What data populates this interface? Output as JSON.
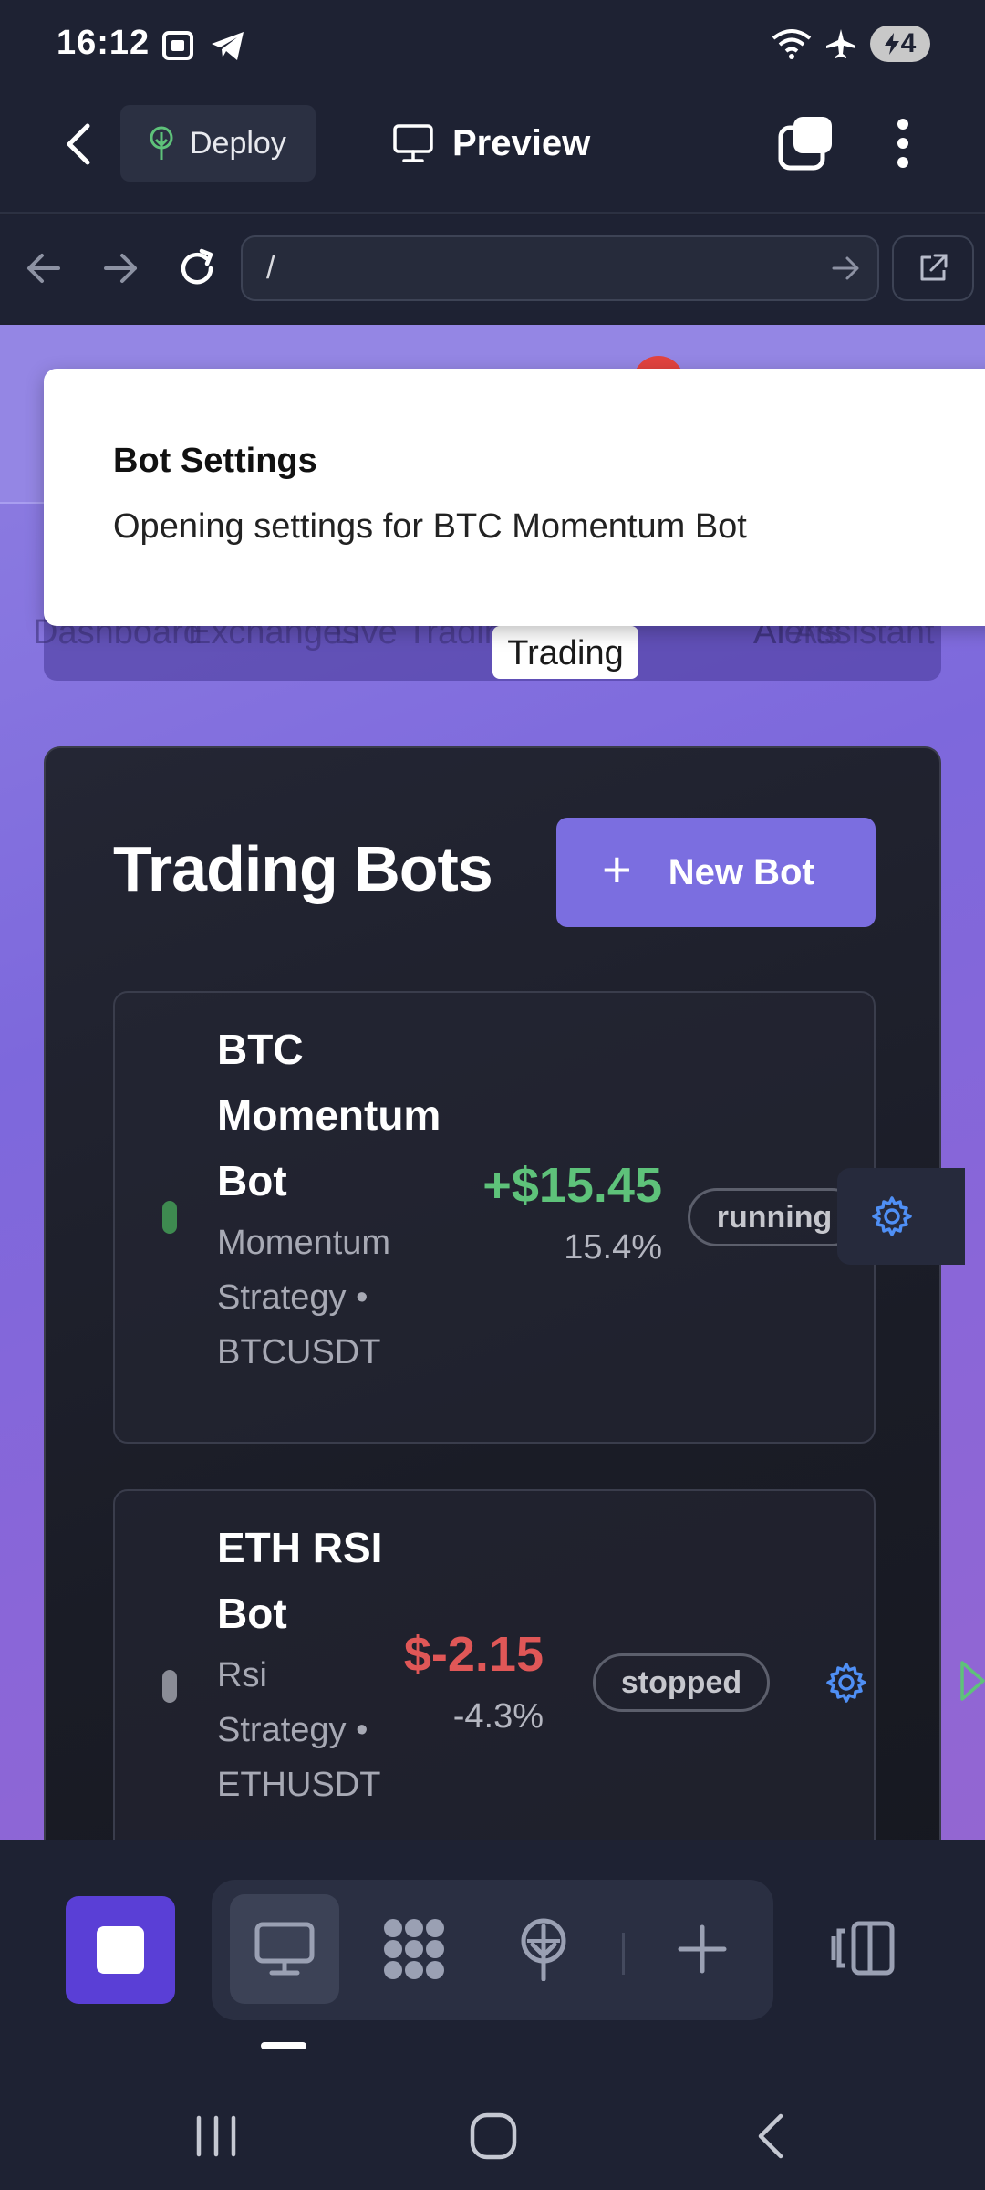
{
  "status_bar": {
    "time": "16:12",
    "battery_level": "4",
    "icons": [
      "screenshot-icon",
      "telegram-icon",
      "wifi-icon",
      "airplane-icon",
      "battery-charging-icon"
    ]
  },
  "app_bar": {
    "deploy_label": "Deploy",
    "preview_label": "Preview"
  },
  "browser": {
    "url": "/"
  },
  "web": {
    "nav_links": [
      "Dashboard",
      "Exchanges",
      "Live Trading",
      "Trading Bots",
      "Alerts",
      "AI Assistant"
    ],
    "nav_active": "Trading Bots",
    "toast": {
      "title": "Bot Settings",
      "description": "Opening settings for BTC Momentum Bot"
    },
    "panel": {
      "title": "Trading Bots",
      "new_bot_label": "New Bot",
      "new_bot_plus": "+"
    },
    "bots": [
      {
        "name_lines": [
          "BTC",
          "Momentum",
          "Bot"
        ],
        "sub_lines": [
          "Momentum",
          "Strategy •",
          "BTCUSDT"
        ],
        "pnl": "+$15.45",
        "pct": "15.4%",
        "status": "running",
        "status_color": "#3e8a50",
        "pnl_color": "#5ec27a"
      },
      {
        "name_lines": [
          "ETH RSI",
          "Bot"
        ],
        "sub_lines": [
          "Rsi",
          "Strategy •",
          "ETHUSDT"
        ],
        "pnl": "$-2.15",
        "pct": "-4.3%",
        "status": "stopped",
        "status_color": "#8a8c96",
        "pnl_color": "#e05757"
      }
    ]
  },
  "colors": {
    "accent": "#7b6ee0",
    "stop_button": "#5a3fd6",
    "gear_blue": "#4f8ff5"
  }
}
